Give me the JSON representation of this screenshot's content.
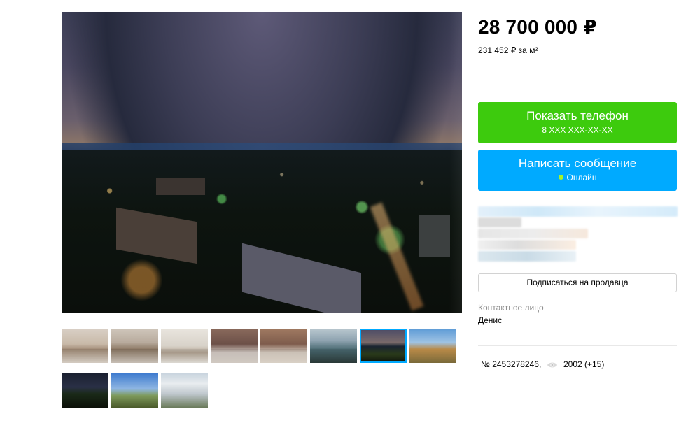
{
  "price": "28 700 000 ₽",
  "price_per_sqm": "231 452 ₽ за м²",
  "phone_button": {
    "label": "Показать телефон",
    "number": "8 XXX XXX-XX-XX",
    "color": "#3dcb0d"
  },
  "message_button": {
    "label": "Написать сообщение",
    "status": "Онлайн",
    "color": "#00aaff"
  },
  "subscribe_button": "Подписаться на продавца",
  "contact": {
    "label": "Контактное лицо",
    "name": "Денис"
  },
  "listing": {
    "number": "№ 2453278246,",
    "views": "2002 (+15)"
  },
  "gallery": {
    "main_photo": "night-city-view",
    "thumbnails": [
      "living-room",
      "kitchen-living",
      "empty-room",
      "bedroom",
      "bedroom-2",
      "panoramic-room",
      "night-city-view",
      "day-city-view",
      "night-view-2",
      "day-view-2",
      "building-exterior"
    ],
    "selected_index": 6
  }
}
